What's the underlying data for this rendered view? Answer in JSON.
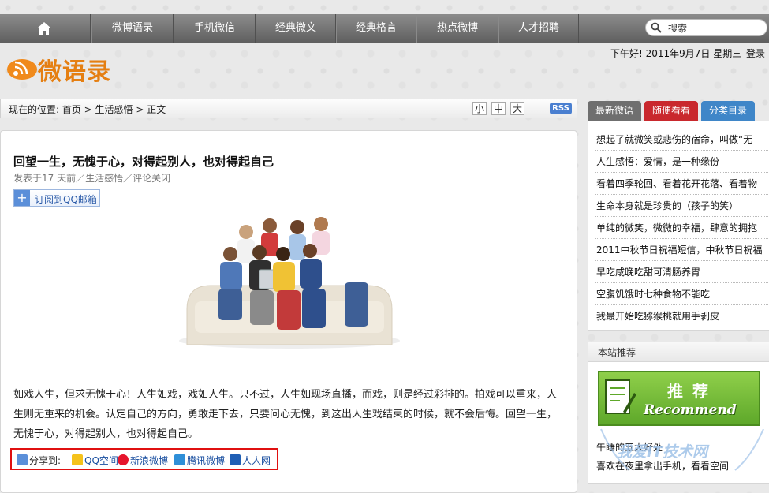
{
  "nav": {
    "items": [
      "微博语录",
      "手机微信",
      "经典微文",
      "经典格言",
      "热点微博",
      "人才招聘"
    ],
    "search_placeholder": "搜索"
  },
  "header": {
    "logo_text": "微语录",
    "greeting": "下午好! 2011年9月7日 星期三",
    "login": "登录"
  },
  "breadcrumb": {
    "text": "现在的位置: 首页 > 生活感悟 > 正文",
    "font_sizes": [
      "小",
      "中",
      "大"
    ],
    "rss": "RSS"
  },
  "article": {
    "title": "回望一生，无愧于心，对得起别人，也对得起自己",
    "meta": "发表于17 天前／生活感悟／评论关闭",
    "subscribe_label": "订阅到QQ邮箱",
    "body": "如戏人生，但求无愧于心！人生如戏，戏如人生。只不过，人生如现场直播，而戏，则是经过彩排的。拍戏可以重来，人生则无重来的机会。认定自己的方向，勇敢走下去，只要问心无愧，到这出人生戏结束的时候，就不会后悔。回望一生，无愧于心，对得起别人，也对得起自己。",
    "share": {
      "label": "分享到:",
      "targets": [
        "QQ空间",
        "新浪微博",
        "腾讯微博",
        "人人网"
      ]
    }
  },
  "sidebar": {
    "tabs": [
      {
        "label": "最新微语",
        "color": "#6f6f6f"
      },
      {
        "label": "随便看看",
        "color": "#c9282d"
      },
      {
        "label": "分类目录",
        "color": "#3f86c8"
      }
    ],
    "items": [
      "想起了就微笑或悲伤的宿命，叫做“无",
      "人生感悟：爱情，是一种缘份",
      "看着四季轮回、看着花开花落、看着物",
      "生命本身就是珍贵的（孩子的笑）",
      "单纯的微笑，微微的幸福，肆意的拥抱",
      "2011中秋节日祝福短信，中秋节日祝福",
      "早吃咸晚吃甜可清肠养胃",
      "空腹饥饿时七种食物不能吃",
      "我最开始吃猕猴桃就用手剥皮"
    ],
    "recommend": {
      "title": "本站推荐",
      "banner_cn": "推荐",
      "banner_en": "Recommend",
      "items": [
        "午睡的五大好处",
        "喜欢在夜里拿出手机，看看空间"
      ]
    }
  },
  "watermark": "我爱IT技术网"
}
